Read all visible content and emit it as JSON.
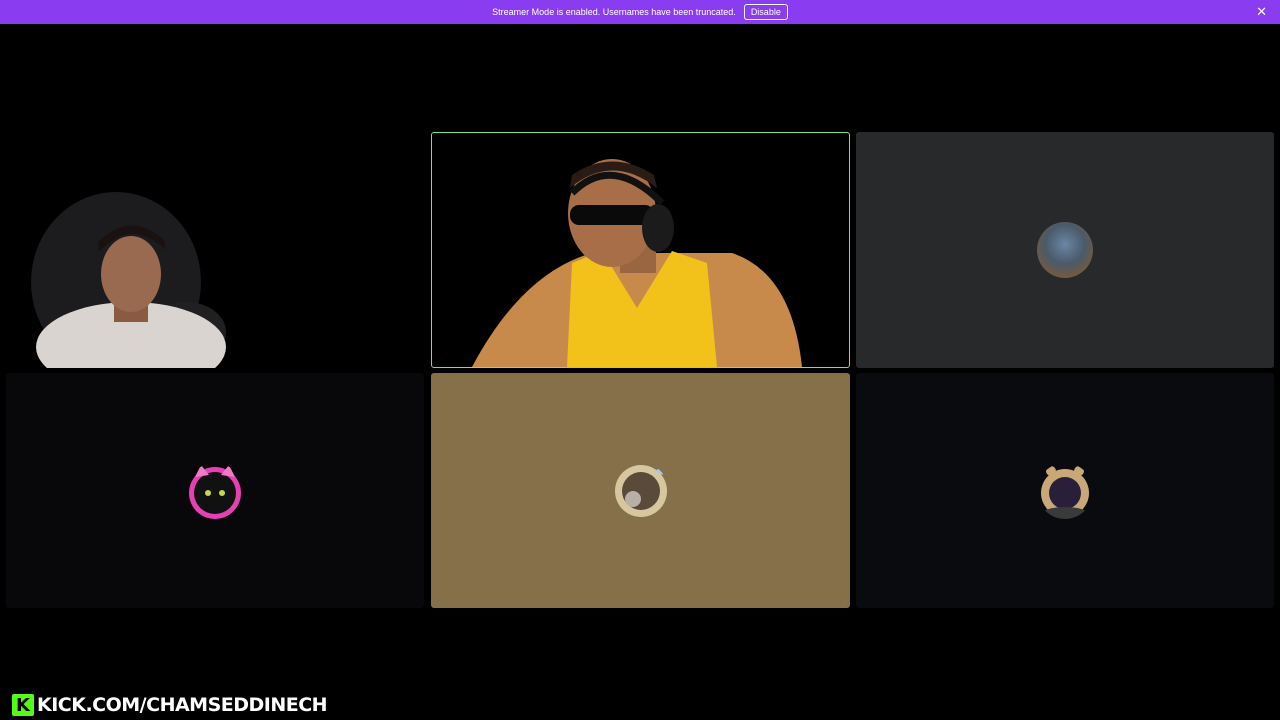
{
  "banner": {
    "message": "Streamer Mode is enabled. Usernames have been truncated.",
    "disable_label": "Disable",
    "close_icon": "close-icon",
    "color": "#8a3cf0"
  },
  "tiles": [
    {
      "type": "camera",
      "speaking": false
    },
    {
      "type": "camera",
      "speaking": true
    },
    {
      "type": "avatar",
      "background": "#28292b"
    },
    {
      "type": "avatar",
      "background": "#08080a"
    },
    {
      "type": "avatar",
      "background": "#86704a"
    },
    {
      "type": "avatar",
      "background": "#0a0b0f"
    }
  ],
  "footer": {
    "k_letter": "K",
    "text": "KICK.COM/CHAMSEDDINECH",
    "accent": "#53fc18"
  }
}
